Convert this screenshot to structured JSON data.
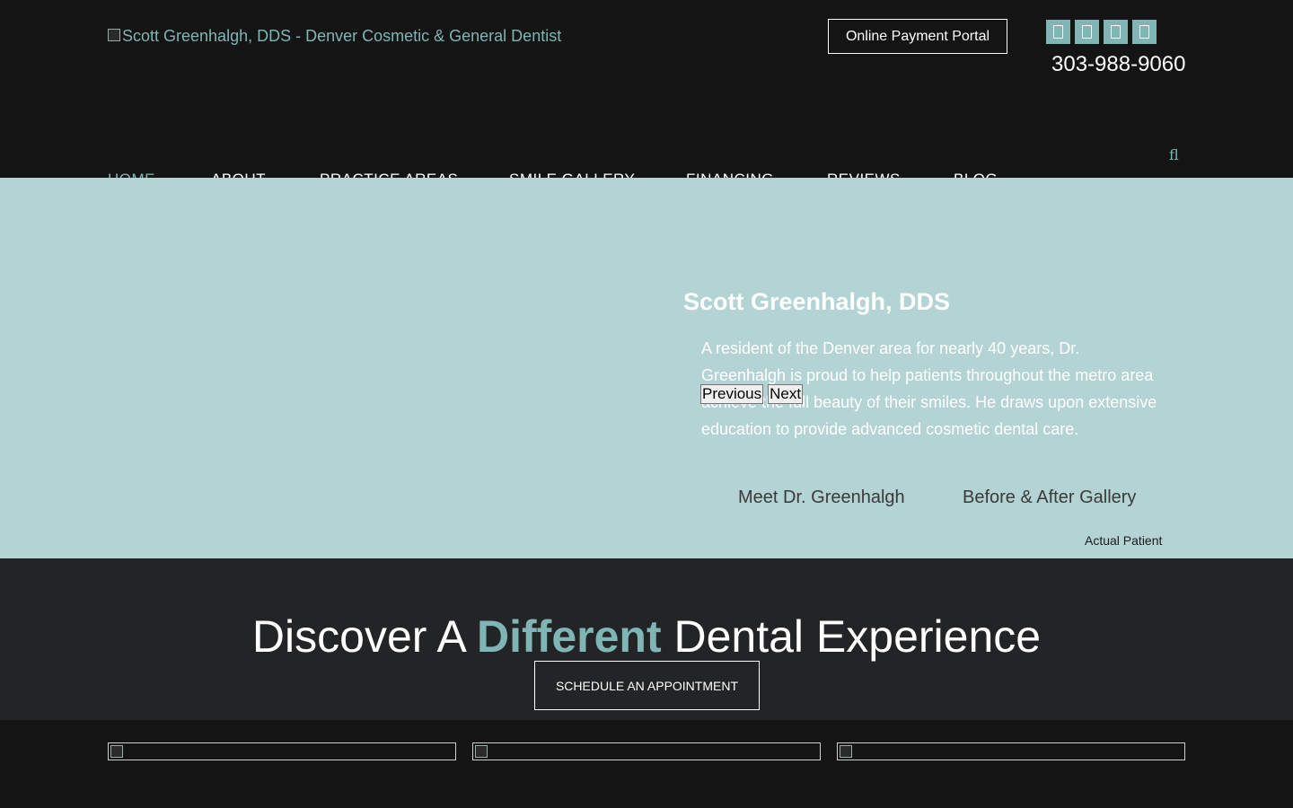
{
  "header": {
    "logo_alt": "Scott Greenhalgh, DDS - Denver Cosmetic & General Dentist",
    "payment_button": "Online Payment Portal",
    "phone": "303-988-9060",
    "social_icons": [
      "social-icon",
      "social-icon",
      "social-icon",
      "social-icon"
    ],
    "search_glyph": "fl"
  },
  "nav": {
    "items": [
      "HOME",
      "ABOUT",
      "PRACTICE AREAS",
      "SMILE GALLERY",
      "FINANCING",
      "REVIEWS",
      "BLOG"
    ],
    "active": "HOME"
  },
  "hero": {
    "title": "Scott Greenhalgh, DDS",
    "description": "A resident of the Denver area for nearly 40 years, Dr. Greenhalgh is proud to help patients throughout the metro area achieve the full beauty of their smiles. He draws upon extensive education to provide advanced cosmetic dental care.",
    "prev_label": "Previous",
    "next_label": "Next",
    "link_meet": "Meet Dr. Greenhalgh",
    "link_gallery": "Before & After Gallery",
    "caption": "Actual Patient"
  },
  "band": {
    "heading_pre": "Discover A ",
    "heading_accent": "Different",
    "heading_post": " Dental Experience",
    "button": "SCHEDULE AN APPOINTMENT"
  },
  "colors": {
    "accent": "#7fb5b4",
    "hero_bg": "#b4d3d4",
    "page_bg": "#141414",
    "band_bg": "#232425"
  }
}
